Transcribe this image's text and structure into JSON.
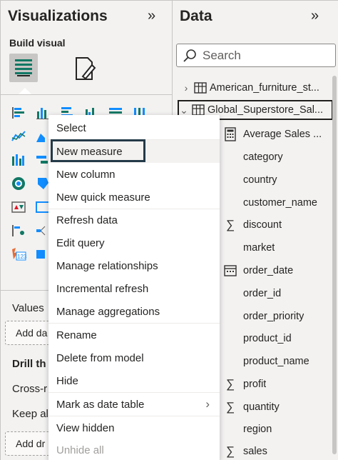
{
  "visualizations": {
    "title": "Visualizations",
    "collapse_icon": "double-chevron-right",
    "build_visual_label": "Build visual",
    "values_label": "Values",
    "add_data_label": "Add da",
    "drill_through_label": "Drill th",
    "cross_report_label": "Cross-r",
    "keep_all_label": "Keep al",
    "add_drill_label": "Add dr"
  },
  "data_pane": {
    "title": "Data",
    "collapse_icon": "double-chevron-right",
    "search_placeholder": "Search",
    "tables": [
      {
        "name": "American_furniture_st...",
        "expanded": false
      },
      {
        "name": "Global_Superstore_Sal...",
        "expanded": true
      }
    ],
    "fields": [
      {
        "name": "Average Sales ...",
        "icon": "calculator"
      },
      {
        "name": "category",
        "icon": ""
      },
      {
        "name": "country",
        "icon": ""
      },
      {
        "name": "customer_name",
        "icon": ""
      },
      {
        "name": "discount",
        "icon": "sigma"
      },
      {
        "name": "market",
        "icon": ""
      },
      {
        "name": "order_date",
        "icon": "calendar"
      },
      {
        "name": "order_id",
        "icon": ""
      },
      {
        "name": "order_priority",
        "icon": ""
      },
      {
        "name": "product_id",
        "icon": ""
      },
      {
        "name": "product_name",
        "icon": ""
      },
      {
        "name": "profit",
        "icon": "sigma"
      },
      {
        "name": "quantity",
        "icon": "sigma"
      },
      {
        "name": "region",
        "icon": ""
      },
      {
        "name": "sales",
        "icon": "sigma"
      }
    ],
    "sigma_glyph": "∑"
  },
  "context_menu": {
    "items": [
      {
        "label": "Select",
        "state": "normal"
      },
      {
        "label": "New measure",
        "state": "hover"
      },
      {
        "label": "New column",
        "state": "normal"
      },
      {
        "label": "New quick measure",
        "state": "normal"
      },
      {
        "label": "Refresh data",
        "state": "normal"
      },
      {
        "label": "Edit query",
        "state": "normal"
      },
      {
        "label": "Manage relationships",
        "state": "normal"
      },
      {
        "label": "Incremental refresh",
        "state": "normal"
      },
      {
        "label": "Manage aggregations",
        "state": "normal"
      },
      {
        "label": "Rename",
        "state": "normal"
      },
      {
        "label": "Delete from model",
        "state": "normal"
      },
      {
        "label": "Hide",
        "state": "normal"
      },
      {
        "label": "Mark as date table",
        "state": "submenu"
      },
      {
        "label": "View hidden",
        "state": "normal"
      },
      {
        "label": "Unhide all",
        "state": "disabled"
      }
    ],
    "submenu_arrow": "›"
  },
  "colors": {
    "pane_bg": "#f3f2f1",
    "highlight_border": "#243a48",
    "selected_table_border": "#201f1e",
    "chart_teal": "#117865",
    "chart_blue": "#118dff",
    "chart_red": "#e81123",
    "chart_orange": "#e66c37"
  }
}
